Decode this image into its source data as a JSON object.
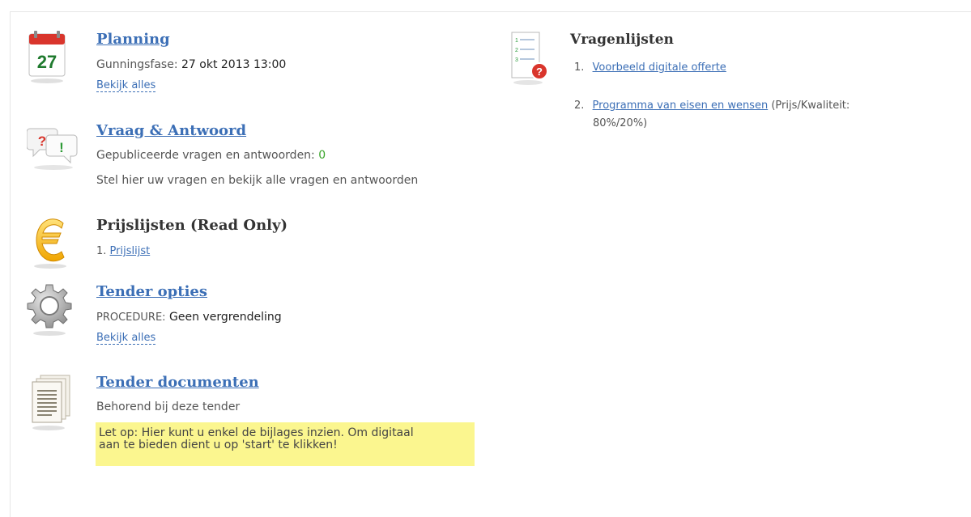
{
  "planning": {
    "title": "Planning",
    "calendar_day": "27",
    "phase_label": "Gunningsfase:",
    "phase_value": "27 okt 2013 13:00",
    "view_all": "Bekijk alles"
  },
  "qa": {
    "title": "Vraag & Antwoord",
    "published_label": "Gepubliceerde vragen en antwoorden:",
    "published_count": "0",
    "description": "Stel hier uw vragen en bekijk alle vragen en antwoorden",
    "icon_question": "?",
    "icon_exclaim": "!"
  },
  "pricelists": {
    "title": "Prijslijsten (Read Only)",
    "items": [
      {
        "number": "1.",
        "label": "Prijslijst"
      }
    ]
  },
  "tender_options": {
    "title": "Tender opties",
    "procedure_label": "PROCEDURE:",
    "procedure_value": "Geen vergrendeling",
    "view_all": "Bekijk alles"
  },
  "tender_documents": {
    "title": "Tender documenten",
    "subtitle": "Behorend bij deze tender",
    "note_line1": "Let op: Hier kunt u enkel de bijlages inzien. Om digitaal",
    "note_line2": "aan te bieden dient u op 'start' te klikken!"
  },
  "questionnaires": {
    "title": "Vragenlijsten",
    "items": [
      {
        "number": "1.",
        "label": "Voorbeeld digitale offerte",
        "extra_line1": "",
        "extra_line2": ""
      },
      {
        "number": "2.",
        "label": "Programma van eisen en wensen",
        "extra_line1": "(Prijs/Kwaliteit:",
        "extra_line2": "80%/20%)"
      }
    ],
    "icon_badge": "?"
  },
  "colors": {
    "link": "#3c6fb6",
    "highlight": "#fbf68f",
    "count_green": "#3aa52a",
    "calendar_red": "#d9352c",
    "calendar_green": "#1f7a2e"
  }
}
